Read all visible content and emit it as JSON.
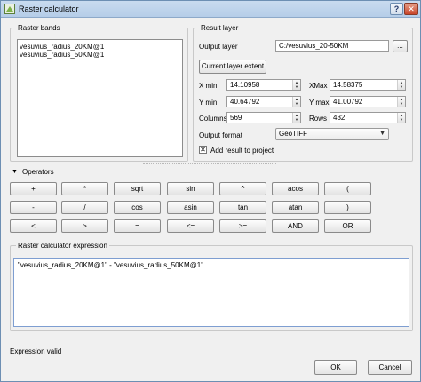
{
  "window": {
    "title": "Raster calculator",
    "help_label": "?",
    "close_label": "✕"
  },
  "raster_bands": {
    "title": "Raster bands",
    "items": [
      "vesuvius_radius_20KM@1",
      "vesuvius_radius_50KM@1"
    ]
  },
  "result_layer": {
    "title": "Result layer",
    "output_layer_label": "Output layer",
    "output_layer_value": "C:/vesuvius_20-50KM",
    "browse_label": "...",
    "current_extent_button": "Current layer extent",
    "xmin_label": "X min",
    "xmin_value": "14.10958",
    "xmax_label": "XMax",
    "xmax_value": "14.58375",
    "ymin_label": "Y min",
    "ymin_value": "40.64792",
    "ymax_label": "Y max",
    "ymax_value": "41.00792",
    "columns_label": "Columns",
    "columns_value": "569",
    "rows_label": "Rows",
    "rows_value": "432",
    "output_format_label": "Output format",
    "output_format_value": "GeoTIFF",
    "add_result_label": "Add result to project",
    "add_result_checked": true
  },
  "operators": {
    "title": "Operators",
    "rows": [
      [
        "+",
        "*",
        "sqrt",
        "sin",
        "^",
        "acos",
        "("
      ],
      [
        "-",
        "/",
        "cos",
        "asin",
        "tan",
        "atan",
        ")"
      ],
      [
        "<",
        ">",
        "=",
        "<=",
        ">=",
        "AND",
        "OR"
      ]
    ]
  },
  "expression": {
    "title": "Raster calculator expression",
    "value": "\"vesuvius_radius_20KM@1\" - \"vesuvius_radius_50KM@1\""
  },
  "status": "Expression valid",
  "footer": {
    "ok_label": "OK",
    "cancel_label": "Cancel"
  },
  "colors": {
    "title_bar": "#b5cde8",
    "close_button": "#c9452a",
    "focus_border": "#7e9ed1"
  }
}
